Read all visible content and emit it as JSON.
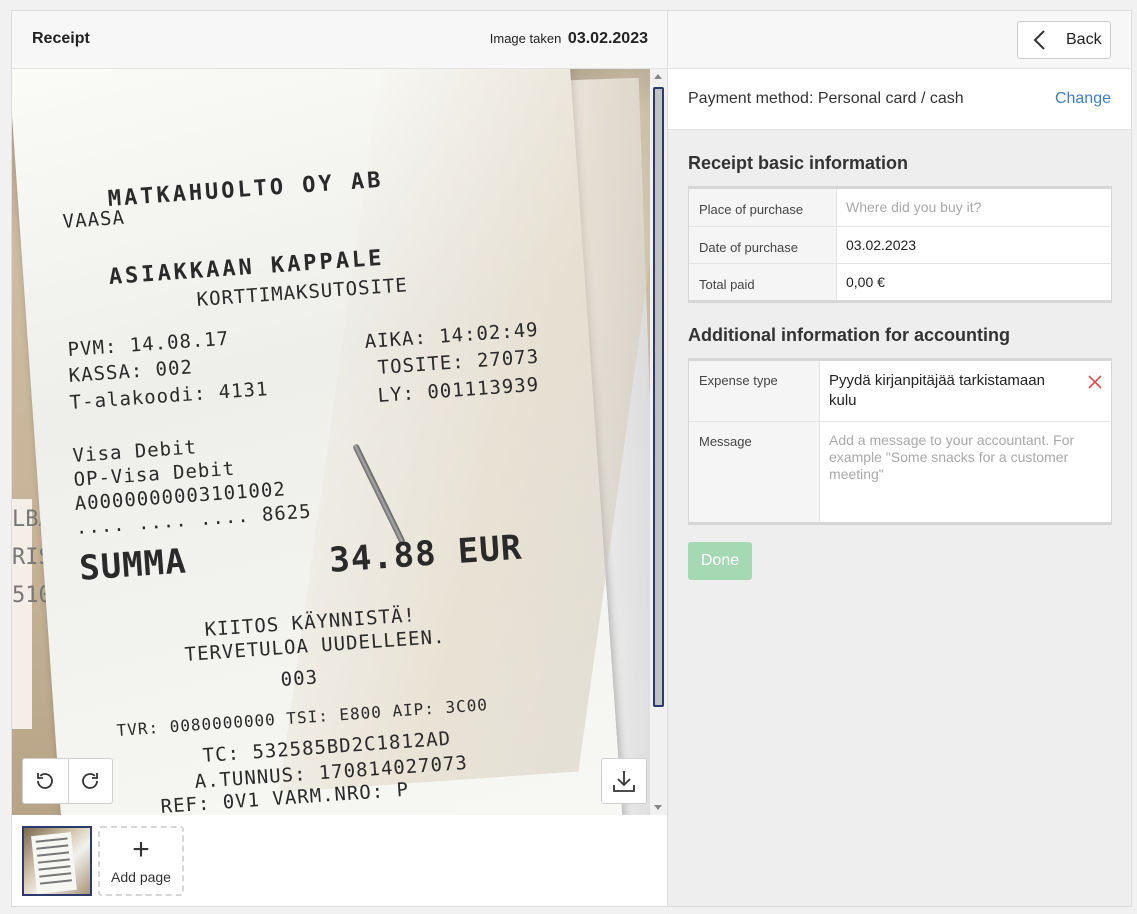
{
  "left_panel": {
    "title": "Receipt",
    "image_taken_label": "Image taken",
    "image_taken_date": "03.02.2023",
    "receipt_image": {
      "lines": [
        "MATKAHUOLTO OY AB",
        "VAASA",
        "ASIAKKAAN KAPPALE",
        "KORTTIMAKSUTOSITE",
        "PVM: 14.08.17",
        "AIKA: 14:02:49",
        "KASSA: 002",
        "TOSITE: 27073",
        "T-alakoodi: 4131",
        "LY: 001113939",
        "Visa Debit",
        "OP-Visa Debit",
        "A0000000003101002",
        ".... .... .... 8625",
        "SUMMA",
        "34.88 EUR",
        "KIITOS KÄYNNISTÄ!",
        "TERVETULOA UUDELLEEN.",
        "003",
        "TVR: 0080000000 TSI: E800 AIP: 3C00",
        "TC: 532585BD2C1812AD",
        "A.TUNNUS: 170814027073",
        "REF: 0V1 VARM.NRO:          P"
      ]
    },
    "tools": {
      "rotate_left_icon": "rotate-left-icon",
      "rotate_right_icon": "rotate-right-icon",
      "download_icon": "download-icon"
    },
    "pages": {
      "add_page_label": "Add page"
    }
  },
  "right_panel": {
    "back_label": "Back",
    "payment_method_text": "Payment method: Personal card / cash",
    "change_label": "Change",
    "basic_info": {
      "title": "Receipt basic information",
      "rows": [
        {
          "label": "Place of purchase",
          "placeholder": "Where did you buy it?",
          "value": ""
        },
        {
          "label": "Date of purchase",
          "value": "03.02.2023"
        },
        {
          "label": "Total paid",
          "value": "0,00 €"
        }
      ]
    },
    "accounting": {
      "title": "Additional information for accounting",
      "expense_type_label": "Expense type",
      "expense_type_value": "Pyydä kirjanpitäjää tarkistamaan kulu",
      "message_label": "Message",
      "message_placeholder": "Add a message to your accountant. For example \"Some snacks for a customer meeting\""
    },
    "done_label": "Done"
  },
  "colors": {
    "link": "#3c7fc4",
    "done_disabled": "#a5d9b3",
    "clear_icon": "#e04848",
    "thumb_selected_border": "#2b3a6b"
  }
}
